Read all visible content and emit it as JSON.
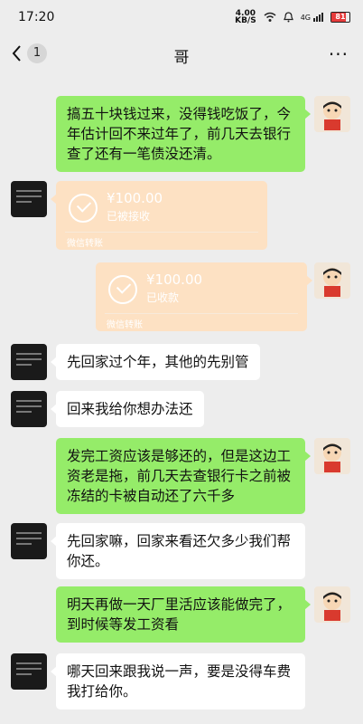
{
  "status_bar": {
    "time": "17:20",
    "net_speed_value": "4.00",
    "net_speed_unit": "KB/S",
    "signal_label": "4G",
    "battery": "81"
  },
  "nav": {
    "back_badge": "1",
    "title": "哥",
    "more": "···"
  },
  "messages": [
    {
      "side": "right",
      "type": "text",
      "text": "搞五十块钱过来，没得钱吃饭了，今年估计回不来过年了，前几天去银行查了还有一笔债没还清。"
    },
    {
      "side": "left",
      "type": "transfer",
      "amount": "¥100.00",
      "status": "已被接收",
      "footer": "微信转账"
    },
    {
      "side": "right",
      "type": "transfer",
      "amount": "¥100.00",
      "status": "已收款",
      "footer": "微信转账"
    },
    {
      "side": "left",
      "type": "text",
      "text": "先回家过个年，其他的先别管"
    },
    {
      "side": "left",
      "type": "text",
      "text": "回来我给你想办法还"
    },
    {
      "side": "right",
      "type": "text",
      "text": "发完工资应该是够还的，但是这边工资老是拖，前几天去查银行卡之前被冻结的卡被自动还了六千多"
    },
    {
      "side": "left",
      "type": "text",
      "text": "先回家嘛，回家来看还欠多少我们帮你还。"
    },
    {
      "side": "right",
      "type": "text",
      "text": "明天再做一天厂里活应该能做完了，到时候等发工资看"
    },
    {
      "side": "left",
      "type": "text",
      "text": "哪天回来跟我说一声，要是没得车费我打给你。"
    }
  ]
}
